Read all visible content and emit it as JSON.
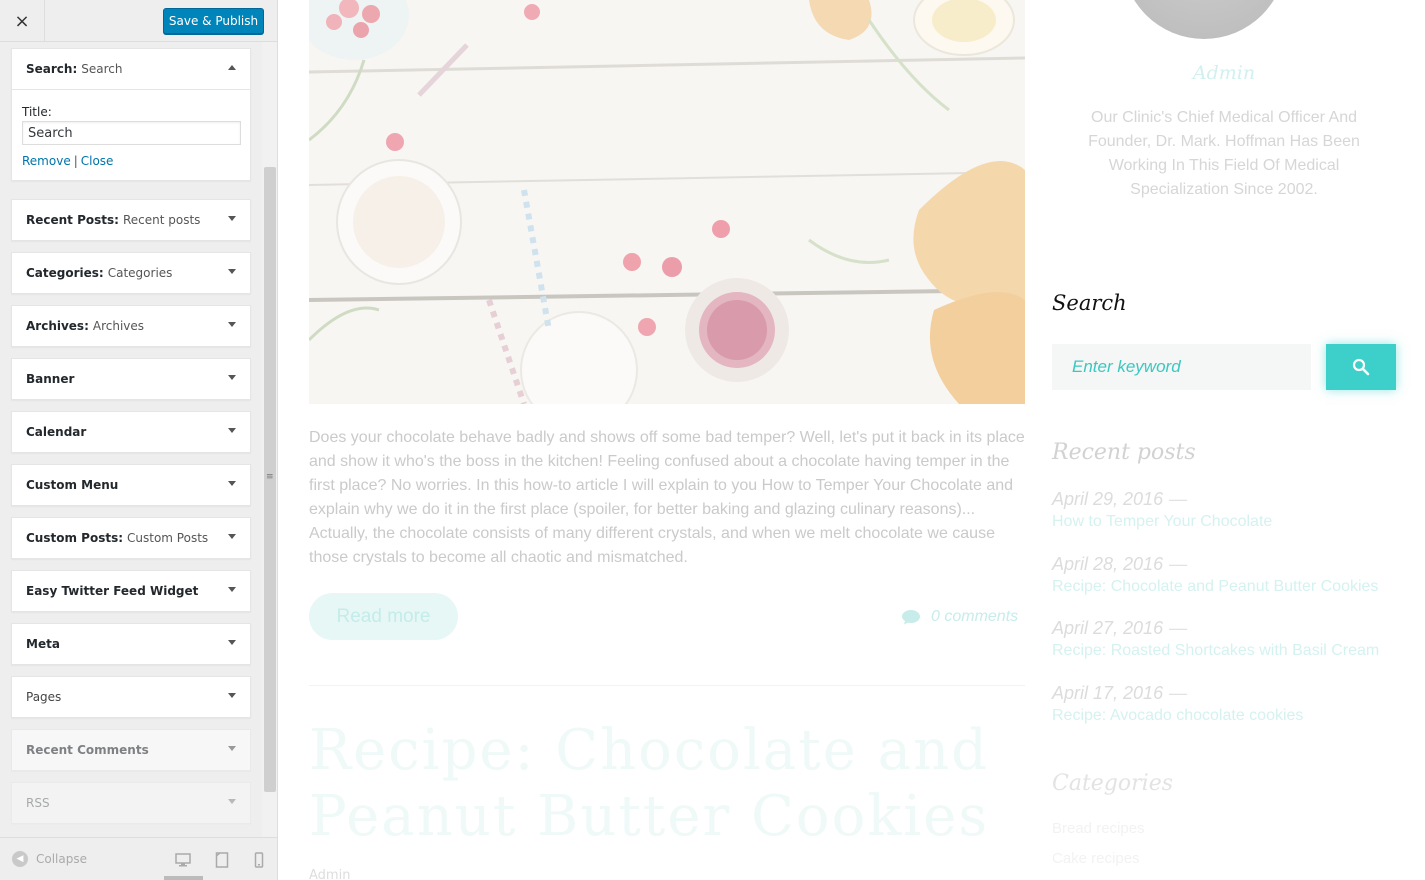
{
  "customizer": {
    "close_label": "×",
    "publish_label": "Save & Publish",
    "open_widget": {
      "type": "Search:",
      "title": "Search",
      "field_label": "Title:",
      "field_value": "Search",
      "remove_label": "Remove",
      "separator": "|",
      "close_label": "Close"
    },
    "widgets": [
      {
        "type": "Recent Posts:",
        "title": "Recent posts"
      },
      {
        "type": "Categories:",
        "title": "Categories"
      },
      {
        "type": "Archives:",
        "title": "Archives"
      },
      {
        "type": "Banner",
        "title": ""
      },
      {
        "type": "Calendar",
        "title": ""
      },
      {
        "type": "Custom Menu",
        "title": ""
      },
      {
        "type": "Custom Posts:",
        "title": "Custom Posts"
      },
      {
        "type": "Easy Twitter Feed Widget",
        "title": ""
      },
      {
        "type": "Meta",
        "title": ""
      },
      {
        "type": "Pages",
        "title": ""
      },
      {
        "type": "Recent Comments",
        "title": ""
      },
      {
        "type": "RSS",
        "title": ""
      }
    ],
    "collapse_label": "Collapse",
    "drag_handle": "≡"
  },
  "preview": {
    "excerpt": "Does your chocolate behave badly and shows off some bad temper? Well, let's put it back in its place and show it who's the boss in the kitchen! Feeling confused about a chocolate having temper in the first place? No worries. In this how-to article I will explain to you How to Temper Your Chocolate and explain why we do it in the first place (spoiler, for better baking and glazing culinary reasons)... Actually, the chocolate consists of many different crystals, and when we melt chocolate we cause those crystals to become all chaotic and mismatched.",
    "read_more": "Read more",
    "comments": "0 comments",
    "post2_title": "Recipe: Chocolate and Peanut Butter Cookies",
    "post2_meta": "Admin",
    "sidebar": {
      "author_name": "Admin",
      "author_bio": "Our Clinic's Chief Medical Officer And Founder, Dr. Mark. Hoffman Has Been Working In This Field Of Medical Specialization Since 2002.",
      "search_heading": "Search",
      "search_placeholder": "Enter keyword",
      "recent_heading": "Recent posts",
      "recent": [
        {
          "date": "April 29, 2016",
          "title": "How to Temper Your Chocolate"
        },
        {
          "date": "April 28, 2016",
          "title": "Recipe: Chocolate and Peanut Butter Cookies"
        },
        {
          "date": "April 27, 2016",
          "title": "Recipe: Roasted Shortcakes with Basil Cream"
        },
        {
          "date": "April 17, 2016",
          "title": "Recipe: Avocado chocolate cookies"
        }
      ],
      "dash": "—",
      "categories_heading": "Categories",
      "categories": [
        "Bread recipes",
        "Cake recipes"
      ]
    }
  },
  "colors": {
    "publish": "#0085ba",
    "accent": "#3dcfc9",
    "link": "#0073aa"
  }
}
